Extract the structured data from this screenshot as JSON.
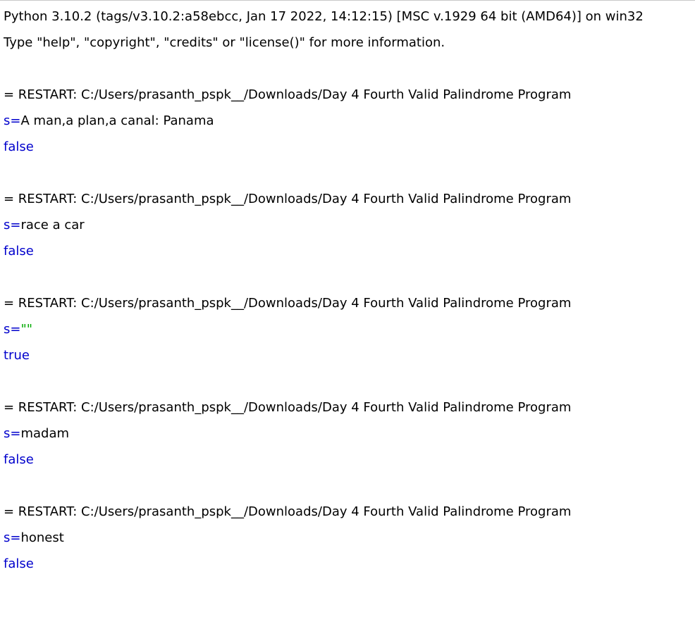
{
  "banner": {
    "line1": "Python 3.10.2 (tags/v3.10.2:a58ebcc, Jan 17 2022, 14:12:15) [MSC v.1929 64 bit (AMD64)] on win32",
    "line2": "Type \"help\", \"copyright\", \"credits\" or \"license()\" for more information."
  },
  "runs": [
    {
      "restart": "= RESTART: C:/Users/prasanth_pspk__/Downloads/Day 4 Fourth Valid Palindrome Program",
      "prompt": "s=",
      "input": "A man,a plan,a canal: Panama",
      "output": "false"
    },
    {
      "restart": "= RESTART: C:/Users/prasanth_pspk__/Downloads/Day 4 Fourth Valid Palindrome Program",
      "prompt": "s=",
      "input": "race a car",
      "output": "false"
    },
    {
      "restart": "= RESTART: C:/Users/prasanth_pspk__/Downloads/Day 4 Fourth Valid Palindrome Program",
      "prompt": "s=",
      "input": "\"\"",
      "output": "true"
    },
    {
      "restart": "= RESTART: C:/Users/prasanth_pspk__/Downloads/Day 4 Fourth Valid Palindrome Program",
      "prompt": "s=",
      "input": "madam",
      "output": "false"
    },
    {
      "restart": "= RESTART: C:/Users/prasanth_pspk__/Downloads/Day 4 Fourth Valid Palindrome Program",
      "prompt": "s=",
      "input": "honest",
      "output": "false"
    }
  ],
  "colors": {
    "stdout": "#0000cc",
    "prompt": "#0000cc",
    "string_literal": "#00aa00",
    "text": "#000000",
    "background": "#ffffff"
  }
}
